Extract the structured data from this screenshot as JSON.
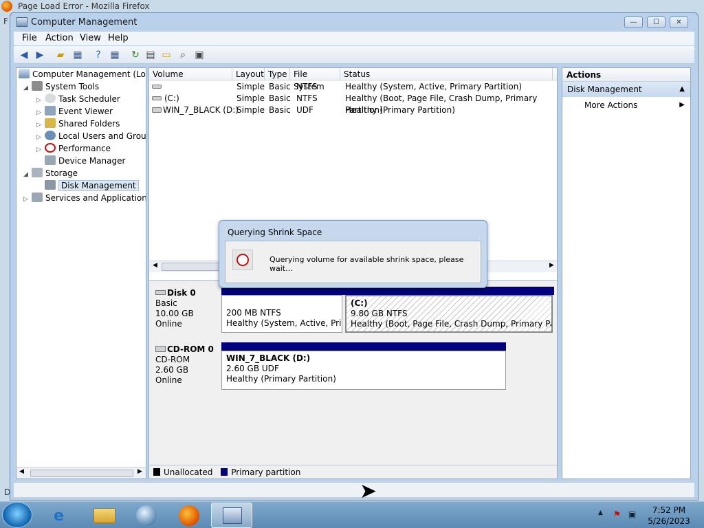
{
  "firefox": {
    "title": "Page Load Error - Mozilla Firefox",
    "edge_letters": [
      "F",
      "D"
    ]
  },
  "window": {
    "title": "Computer Management",
    "minimize": "—",
    "maximize": "☐",
    "close": "✕"
  },
  "menu": [
    "File",
    "Action",
    "View",
    "Help"
  ],
  "toolbar_icons": [
    "back-arrow-icon",
    "forward-arrow-icon",
    "folder-up-icon",
    "show-hide-tree-icon",
    "help-icon",
    "show-hide-action-icon",
    "refresh-icon",
    "properties-icon",
    "open-folder-icon",
    "search-icon",
    "settings-icon"
  ],
  "tree": {
    "root": "Computer Management (Local",
    "system_tools": "System Tools",
    "task_scheduler": "Task Scheduler",
    "event_viewer": "Event Viewer",
    "shared_folders": "Shared Folders",
    "local_users": "Local Users and Groups",
    "performance": "Performance",
    "device_manager": "Device Manager",
    "storage": "Storage",
    "disk_management": "Disk Management",
    "services": "Services and Applications"
  },
  "volume_list": {
    "columns": [
      "Volume",
      "Layout",
      "Type",
      "File System",
      "Status"
    ],
    "rows": [
      {
        "volume": "",
        "layout": "Simple",
        "type": "Basic",
        "fs": "NTFS",
        "status": "Healthy (System, Active, Primary Partition)"
      },
      {
        "volume": "(C:)",
        "layout": "Simple",
        "type": "Basic",
        "fs": "NTFS",
        "status": "Healthy (Boot, Page File, Crash Dump, Primary Partition)"
      },
      {
        "volume": "WIN_7_BLACK (D:)",
        "layout": "Simple",
        "type": "Basic",
        "fs": "UDF",
        "status": "Healthy (Primary Partition)"
      }
    ]
  },
  "disks": [
    {
      "name": "Disk 0",
      "kind": "Basic",
      "size": "10.00 GB",
      "state": "Online",
      "partitions": [
        {
          "label": "",
          "size": "200 MB NTFS",
          "status": "Healthy (System, Active, Prima"
        },
        {
          "label": "(C:)",
          "size": "9.80 GB NTFS",
          "status": "Healthy (Boot, Page File, Crash Dump, Primary Partition"
        }
      ]
    },
    {
      "name": "CD-ROM 0",
      "kind": "CD-ROM",
      "size": "2.60 GB",
      "state": "Online",
      "partitions": [
        {
          "label": "WIN_7_BLACK  (D:)",
          "size": "2.60 GB UDF",
          "status": "Healthy (Primary Partition)"
        }
      ]
    }
  ],
  "legend": {
    "unallocated": "Unallocated",
    "primary": "Primary partition",
    "unallocated_color": "#000000",
    "primary_color": "#00007c"
  },
  "actions": {
    "header": "Actions",
    "section": "Disk Management",
    "more": "More Actions",
    "collapse_glyph": "▲",
    "more_glyph": "▶"
  },
  "dialog": {
    "title": "Querying Shrink Space",
    "message": "Querying volume for available shrink space, please wait..."
  },
  "taskbar": {
    "time": "7:52 PM",
    "date": "5/26/2023"
  }
}
